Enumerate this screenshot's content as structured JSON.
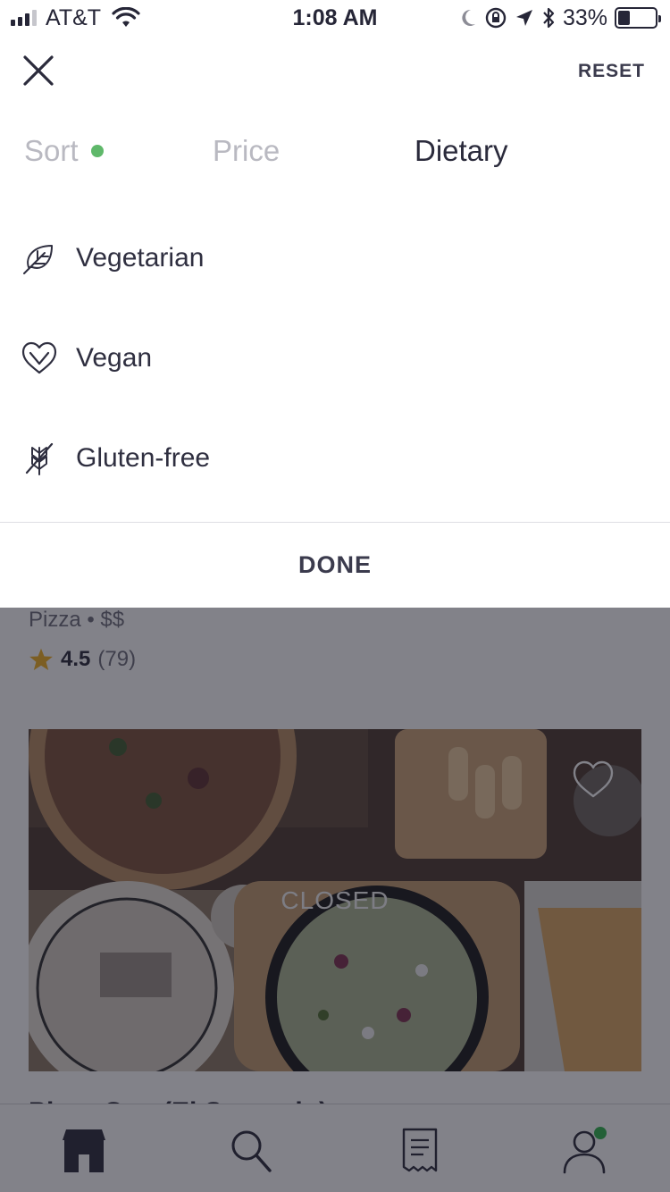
{
  "status_bar": {
    "carrier": "AT&T",
    "time": "1:08 AM",
    "battery_percent": "33%",
    "battery_level": 0.33
  },
  "filter_sheet": {
    "reset_label": "RESET",
    "tabs": [
      {
        "label": "Sort",
        "active": false,
        "indicator_color": "#5fb86a"
      },
      {
        "label": "Price",
        "active": false
      },
      {
        "label": "Dietary",
        "active": true
      }
    ],
    "options": [
      {
        "label": "Vegetarian",
        "icon": "leaf-icon"
      },
      {
        "label": "Vegan",
        "icon": "heart-leaf-icon"
      },
      {
        "label": "Gluten-free",
        "icon": "gluten-free-icon"
      }
    ],
    "done_label": "DONE"
  },
  "restaurant": {
    "cuisine_price": "Pizza • $$",
    "rating": "4.5",
    "review_count": "(79)",
    "status": "CLOSED",
    "next_title": "Pizza Guy (El Segundo)"
  },
  "tab_bar": {
    "items": [
      {
        "icon": "store-icon",
        "active": true
      },
      {
        "icon": "search-icon",
        "active": false
      },
      {
        "icon": "receipt-icon",
        "active": false
      },
      {
        "icon": "account-icon",
        "active": false,
        "badge_color": "#2db34a"
      }
    ]
  },
  "colors": {
    "star": "#f2b01e",
    "sort_dot": "#5fb86a",
    "account_badge": "#2db34a"
  }
}
